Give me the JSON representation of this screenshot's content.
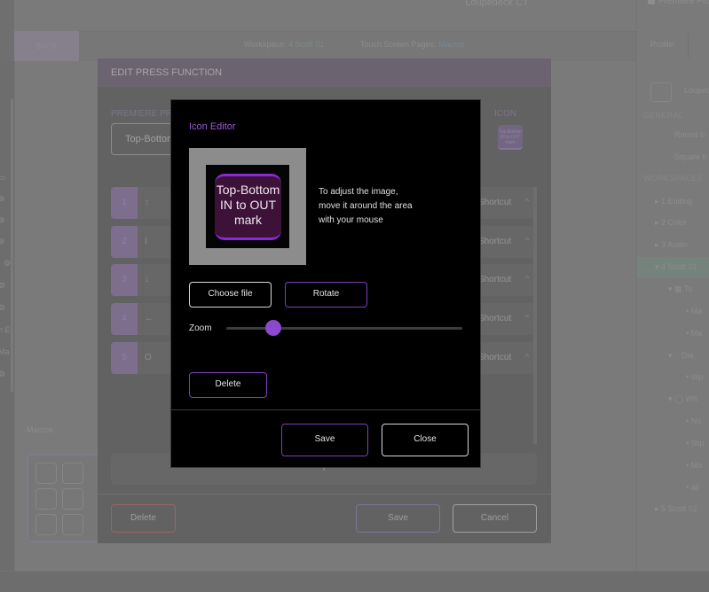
{
  "app": {
    "device_name": "Loupedeck CT",
    "active_app": "Premiere Pro",
    "back_label": "BACK",
    "workspace_label": "Workspace:",
    "workspace_value": "4 Scott 01",
    "touch_pages_label": "Touch Screen Pages:",
    "touch_pages_value": "Macros",
    "profile_label": "Profile:",
    "macros_label": "Macros",
    "left_panel_texts": [
      "n E",
      "Ma"
    ],
    "right_panel": {
      "device_item": "Loupedeck",
      "general_header": "GENERAL",
      "general_items": [
        "Round b",
        "Square b"
      ],
      "workspaces_header": "WORKSPACES",
      "workspaces": [
        {
          "label": "1 Editing",
          "expanded": false
        },
        {
          "label": "2 Color",
          "expanded": false
        },
        {
          "label": "3 Audio",
          "expanded": false
        },
        {
          "label": "4 Scott 01",
          "expanded": true,
          "selected": true
        },
        {
          "label": "5 Scott 02",
          "expanded": false
        }
      ],
      "scott01_children": [
        {
          "label": "To",
          "level": 1
        },
        {
          "label": "Ma",
          "level": 2
        },
        {
          "label": "Ma",
          "level": 2
        },
        {
          "label": "Dia",
          "level": 1
        },
        {
          "label": "slip",
          "level": 2
        },
        {
          "label": "Wh",
          "level": 1
        },
        {
          "label": "Nu",
          "level": 2
        },
        {
          "label": "Slip",
          "level": 2
        },
        {
          "label": "Mo",
          "level": 2
        },
        {
          "label": "all",
          "level": 2
        }
      ]
    }
  },
  "edit_dialog": {
    "title": "EDIT PRESS FUNCTION",
    "section_label": "PREMIERE PRO",
    "name_value": "Top-Bottom IN to OUT mark",
    "icon_label": "ICON",
    "icon_text": "Top-Bottom IN to OUT mark",
    "steps": [
      {
        "num": "1",
        "symbol": "↑",
        "type": "Shortcut"
      },
      {
        "num": "2",
        "symbol": "I",
        "type": "Shortcut"
      },
      {
        "num": "3",
        "symbol": "↓",
        "type": "Shortcut"
      },
      {
        "num": "4",
        "symbol": "←",
        "type": "Shortcut"
      },
      {
        "num": "5",
        "symbol": "O",
        "type": "Shortcut"
      }
    ],
    "add_symbol": "+",
    "delete_label": "Delete",
    "save_label": "Save",
    "cancel_label": "Cancel"
  },
  "icon_editor": {
    "title": "Icon Editor",
    "preview_lines": [
      "Top-Bottom",
      "IN to OUT",
      "mark"
    ],
    "hint_lines": [
      "To adjust the image,",
      "move it around the area",
      "with your mouse"
    ],
    "choose_file_label": "Choose file",
    "rotate_label": "Rotate",
    "zoom_label": "Zoom",
    "zoom_value_fraction": 0.2,
    "delete_label": "Delete",
    "save_label": "Save",
    "close_label": "Close",
    "accent_color": "#8d48d0",
    "key_background_color": "#3c1238"
  }
}
